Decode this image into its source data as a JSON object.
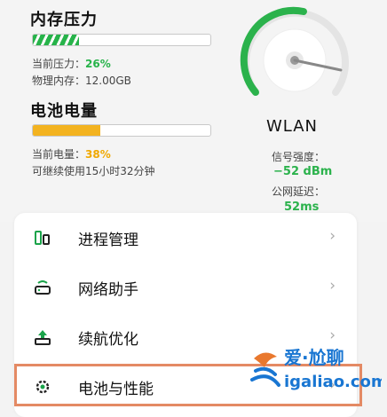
{
  "memory": {
    "title": "内存压力",
    "pressure_label": "当前压力：",
    "pressure_value": "26%",
    "pressure_fraction": 0.26,
    "physical_label": "物理内存：12.00GB",
    "bar_color": "#27b34a"
  },
  "battery": {
    "title": "电池电量",
    "level_label": "当前电量：",
    "level_value": "38%",
    "level_fraction": 0.38,
    "remaining_label": "可继续使用15小时32分钟",
    "bar_color": "#f3b320"
  },
  "wlan": {
    "title": "WLAN",
    "signal_label": "信号强度：",
    "signal_value": "−52 dBm",
    "latency_label": "公网延迟：",
    "latency_value": "52ms",
    "accent": "#2bb24c"
  },
  "menu": {
    "items": [
      {
        "label": "进程管理",
        "icon": "process-icon"
      },
      {
        "label": "网络助手",
        "icon": "router-icon"
      },
      {
        "label": "续航优化",
        "icon": "battery-upload-icon"
      },
      {
        "label": "电池与性能",
        "icon": "settings-gear-icon"
      }
    ],
    "chevron": "›"
  },
  "watermark": {
    "text_top": "爱·尬聊",
    "text_bottom": "igaliao.com"
  }
}
